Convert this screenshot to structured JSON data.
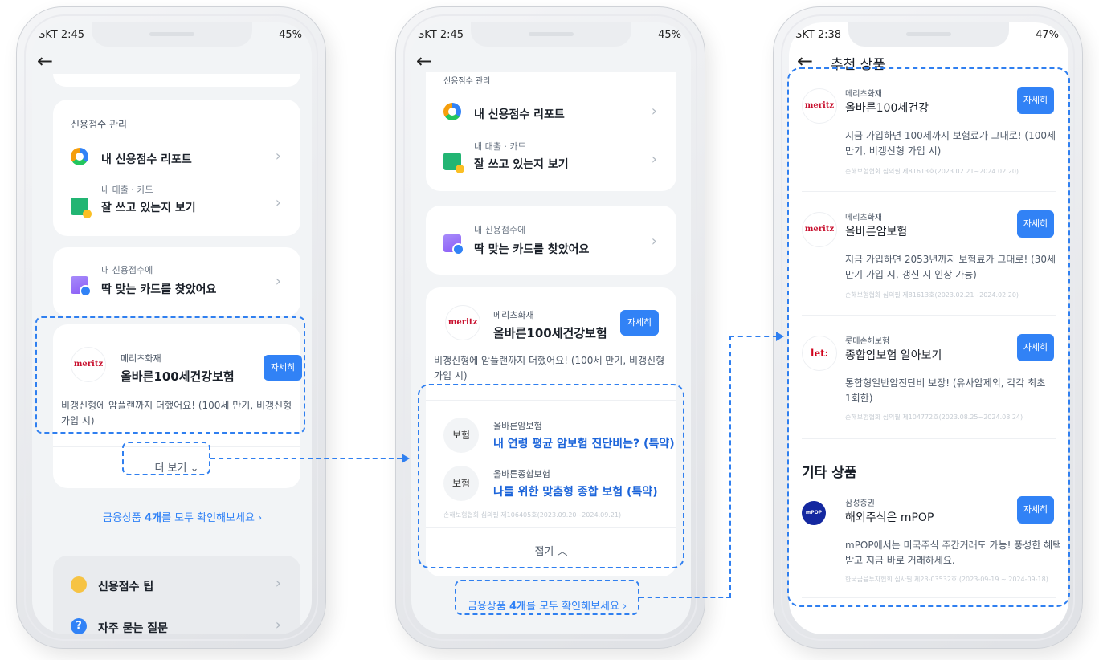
{
  "phone1": {
    "status": {
      "time": "SKT 2:45",
      "right": "45%"
    },
    "credit_mgmt": {
      "title": "신용점수 관리",
      "report": "내 신용점수 리포트",
      "loan_sub": "내 대출 · 카드",
      "loan_main": "잘 쓰고 있는지 보기"
    },
    "card_match": {
      "sub": "내 신용점수에",
      "main": "딱 맞는 카드를 찾았어요"
    },
    "product": {
      "company": "메리츠화재",
      "logo": "meritz",
      "name": "올바른100세건강보험",
      "button": "자세히",
      "desc1": "비갱신형에 암플랜까지 더했어요! (100세 만기, 비갱신형",
      "desc2": "가입 시)"
    },
    "more": "더 보기",
    "all_link_pre": "금융상품 ",
    "all_link_bold": "4개",
    "all_link_post": "를 모두 확인해보세요 ›",
    "tips": "신용점수 팁",
    "faq": "자주 묻는 질문"
  },
  "phone2": {
    "status": {
      "time": "SKT 2:45",
      "right": "45%"
    },
    "credit_mgmt": {
      "title": "신용점수 관리",
      "report": "내 신용점수 리포트",
      "loan_sub": "내 대출 · 카드",
      "loan_main": "잘 쓰고 있는지 보기"
    },
    "card_match": {
      "sub": "내 신용점수에",
      "main": "딱 맞는 카드를 찾았어요"
    },
    "product": {
      "company": "메리츠화재",
      "logo": "meritz",
      "name": "올바른100세건강보험",
      "button": "자세히",
      "desc1": "비갱신형에 암플랜까지 더했어요! (100세 만기, 비갱신형",
      "desc2": "가입 시)"
    },
    "expanded": [
      {
        "badge": "보험",
        "sub": "올바른암보험",
        "title": "내 연령 평균 암보험 진단비는? (특약)"
      },
      {
        "badge": "보험",
        "sub": "올바른종합보험",
        "title": "나를 위한 맞춤형 종합 보험 (특약)"
      }
    ],
    "fine": "손해보험협회 심의필 제106405호(2023.09.20~2024.09.21)",
    "collapse": "접기",
    "all_link_pre": "금융상품 ",
    "all_link_bold": "4개",
    "all_link_post": "를 모두 확인해보세요 ›"
  },
  "phone3": {
    "status": {
      "time": "SKT 2:38",
      "right": "47%"
    },
    "title": "추천 상품",
    "items": [
      {
        "company": "메리츠화재",
        "logo": "meritz",
        "name": "올바른100세건강",
        "button": "자세히",
        "desc1": "지금 가입하면 100세까지 보험료가 그대로! (100세",
        "desc2": "만기, 비갱신형 가입 시)",
        "fine": "손해보험협회 심의필 제81613호(2023.02.21~2024.02.20)"
      },
      {
        "company": "메리츠화재",
        "logo": "meritz",
        "name": "올바른암보험",
        "button": "자세히",
        "desc1": "지금 가입하면 2053년까지 보험료가 그대로! (30세",
        "desc2": "만기 가입 시, 갱신 시 인상 가능)",
        "fine": "손해보험협회 심의필 제81613호(2023.02.21~2024.02.20)"
      },
      {
        "company": "롯데손해보험",
        "logo": "let:",
        "name": "종합암보험 알아보기",
        "button": "자세히",
        "desc1": "통합형일반암진단비 보장! (유사암제외, 각각 최초",
        "desc2": "1회한)",
        "fine": "손해보험협회 심의필 제104772호(2023.08.25~2024.08.24)"
      }
    ],
    "other_heading": "기타 상품",
    "other": {
      "company": "삼성증권",
      "logo": "mPOP",
      "name": "해외주식은 mPOP",
      "button": "자세히",
      "desc1": "mPOP에서는 미국주식 주간거래도 가능! 풍성한 혜택",
      "desc2": "받고 지금 바로 거래하세요.",
      "fine": "한국금융투자협회 심사필 제23-03532호 (2023-09-19 ~ 2024-09-18)"
    }
  },
  "colors": {
    "accent": "#3182f6",
    "annotation": "#2f7ff0",
    "background": "#f2f4f6"
  }
}
